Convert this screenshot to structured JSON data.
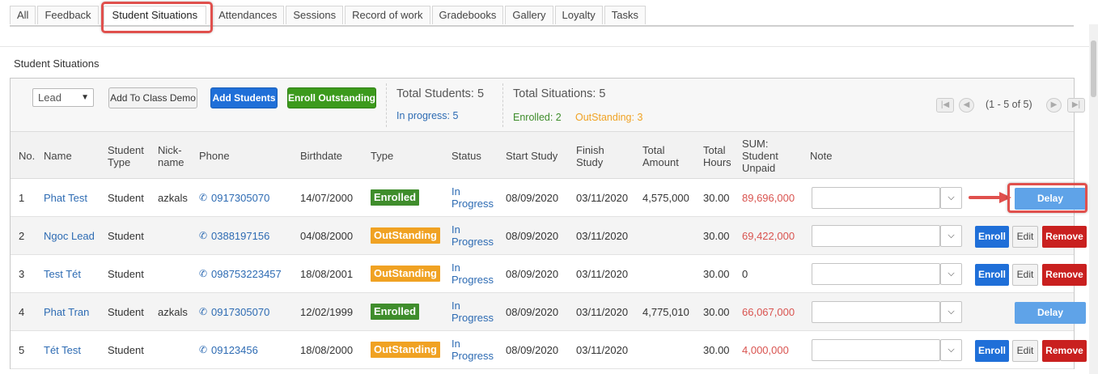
{
  "tabs": [
    "All",
    "Feedback",
    "Student Situations",
    "Attendances",
    "Sessions",
    "Record of work",
    "Gradebooks",
    "Gallery",
    "Loyalty",
    "Tasks"
  ],
  "active_tab": "Student Situations",
  "section_title": "Student Situations",
  "toolbar": {
    "select_value": "Lead",
    "add_to_class_demo": "Add To Class Demo",
    "add_students": "Add Students",
    "enroll_outstanding": "Enroll Outstanding",
    "total_students": "Total Students: 5",
    "in_progress": "In progress: 5",
    "total_situations": "Total Situations: 5",
    "enrolled": "Enrolled: 2",
    "outstanding": "OutStanding: 3",
    "pager_text": "(1 - 5 of 5)"
  },
  "colors": {
    "enrolled": "#3f8d2c",
    "outstanding": "#f0a223",
    "primary": "#1f6fd8",
    "danger": "#c9201f",
    "delay": "#5fa3e8",
    "highlight": "#e0504d"
  },
  "columns": {
    "no": "No.",
    "name": "Name",
    "student_type_1": "Student",
    "student_type_2": "Type",
    "nick_1": "Nick-",
    "nick_2": "name",
    "phone": "Phone",
    "birthdate": "Birthdate",
    "type": "Type",
    "status": "Status",
    "start_study": "Start Study",
    "finish_1": "Finish",
    "finish_2": "Study",
    "amount_1": "Total",
    "amount_2": "Amount",
    "hours_1": "Total",
    "hours_2": "Hours",
    "unpaid_1": "SUM:",
    "unpaid_2": "Student",
    "unpaid_3": "Unpaid",
    "note": "Note"
  },
  "rows": [
    {
      "no": "1",
      "name": "Phat Test",
      "student_type": "Student",
      "nickname": "azkals",
      "phone": "0917305070",
      "birthdate": "14/07/2000",
      "type": "Enrolled",
      "status_1": "In",
      "status_2": "Progress",
      "start_study": "08/09/2020",
      "finish_study": "03/11/2020",
      "total_amount": "4,575,000",
      "total_hours": "30.00",
      "unpaid": "89,696,000",
      "delay": "Delay"
    },
    {
      "no": "2",
      "name": "Ngoc Lead",
      "student_type": "Student",
      "nickname": "",
      "phone": "0388197156",
      "birthdate": "04/08/2000",
      "type": "OutStanding",
      "status_1": "In",
      "status_2": "Progress",
      "start_study": "08/09/2020",
      "finish_study": "03/11/2020",
      "total_amount": "",
      "total_hours": "30.00",
      "unpaid": "69,422,000",
      "enroll": "Enroll",
      "edit": "Edit",
      "remove": "Remove"
    },
    {
      "no": "3",
      "name": "Test Tét",
      "student_type": "Student",
      "nickname": "",
      "phone": "098753223457",
      "birthdate": "18/08/2001",
      "type": "OutStanding",
      "status_1": "In",
      "status_2": "Progress",
      "start_study": "08/09/2020",
      "finish_study": "03/11/2020",
      "total_amount": "",
      "total_hours": "30.00",
      "unpaid": "0",
      "enroll": "Enroll",
      "edit": "Edit",
      "remove": "Remove"
    },
    {
      "no": "4",
      "name": "Phat Tran",
      "student_type": "Student",
      "nickname": "azkals",
      "phone": "0917305070",
      "birthdate": "12/02/1999",
      "type": "Enrolled",
      "status_1": "In",
      "status_2": "Progress",
      "start_study": "08/09/2020",
      "finish_study": "03/11/2020",
      "total_amount": "4,775,010",
      "total_hours": "30.00",
      "unpaid": "66,067,000",
      "delay": "Delay"
    },
    {
      "no": "5",
      "name": "Tét Test",
      "student_type": "Student",
      "nickname": "",
      "phone": "09123456",
      "birthdate": "18/08/2000",
      "type": "OutStanding",
      "status_1": "In",
      "status_2": "Progress",
      "start_study": "08/09/2020",
      "finish_study": "03/11/2020",
      "total_amount": "",
      "total_hours": "30.00",
      "unpaid": "4,000,000",
      "enroll": "Enroll",
      "edit": "Edit",
      "remove": "Remove"
    }
  ]
}
